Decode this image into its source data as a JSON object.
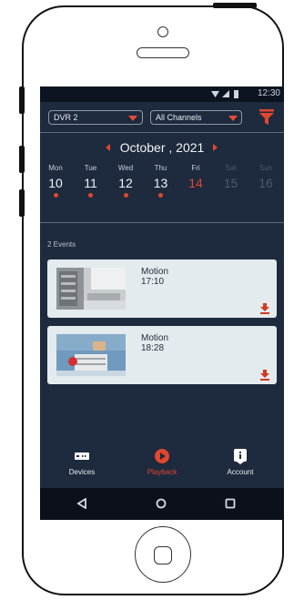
{
  "status_bar": {
    "time": "12:30"
  },
  "filters": {
    "dvr": {
      "selected": "DVR 2"
    },
    "channels": {
      "selected": "All Channels"
    }
  },
  "calendar": {
    "month_label": "October , 2021",
    "days": [
      {
        "weekday": "Mon",
        "date": "10",
        "has_events": true,
        "state": "normal"
      },
      {
        "weekday": "Tue",
        "date": "11",
        "has_events": true,
        "state": "normal"
      },
      {
        "weekday": "Wed",
        "date": "12",
        "has_events": true,
        "state": "normal"
      },
      {
        "weekday": "Thu",
        "date": "13",
        "has_events": true,
        "state": "normal"
      },
      {
        "weekday": "Fri",
        "date": "14",
        "has_events": false,
        "state": "selected"
      },
      {
        "weekday": "Sat",
        "date": "15",
        "has_events": false,
        "state": "disabled"
      },
      {
        "weekday": "Sun",
        "date": "16",
        "has_events": false,
        "state": "disabled"
      }
    ]
  },
  "events": {
    "count_label": "2 Events",
    "items": [
      {
        "type": "Motion",
        "time": "17:10"
      },
      {
        "type": "Motion",
        "time": "18:28"
      }
    ]
  },
  "tabs": [
    {
      "label": "Devices",
      "icon": "devices-icon",
      "active": false
    },
    {
      "label": "Playback",
      "icon": "playback-icon",
      "active": true
    },
    {
      "label": "Account",
      "icon": "account-icon",
      "active": false
    }
  ],
  "colors": {
    "background": "#1e2a3d",
    "accent": "#e0472e",
    "card": "#e4ebee",
    "nav_bar": "#0b1019"
  }
}
